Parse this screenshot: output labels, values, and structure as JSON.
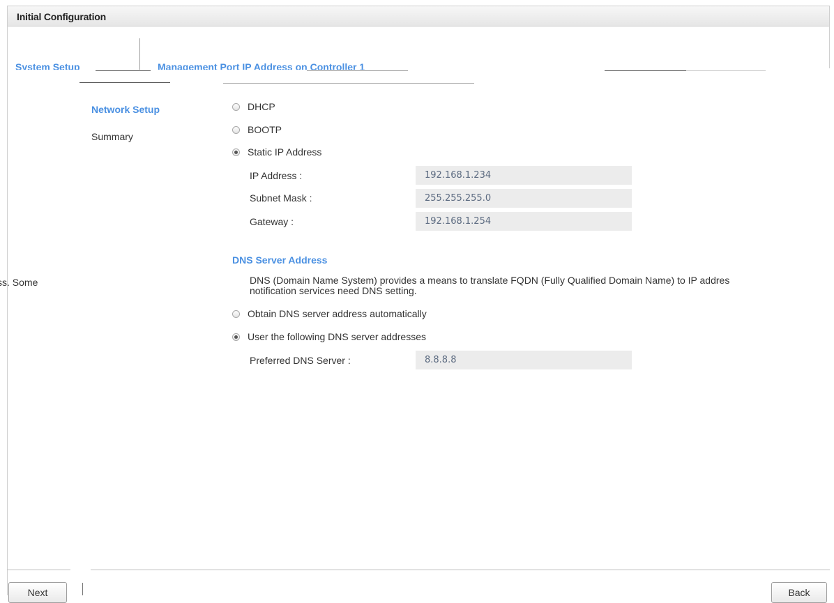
{
  "window": {
    "title": "Initial Configuration"
  },
  "wizard": {
    "top_steps": [
      "System Setup",
      "Management Port IP Address on Controller 1"
    ],
    "steps": [
      "Network Setup",
      "Summary"
    ]
  },
  "ip_config": {
    "options": [
      "DHCP",
      "BOOTP",
      "Static IP Address"
    ],
    "selected": "Static IP Address",
    "fields": [
      {
        "label": "IP Address :",
        "value": "192.168.1.234"
      },
      {
        "label": "Subnet Mask :",
        "value": "255.255.255.0"
      },
      {
        "label": "Gateway :",
        "value": "192.168.1.254"
      }
    ]
  },
  "dns": {
    "title": "DNS Server Address",
    "description_line1": "DNS (Domain Name System) provides a means to translate FQDN (Fully Qualified Domain Name) to IP addres",
    "description_line2": "notification services need DNS setting.",
    "left_clipped_text": "ss. Some",
    "options": [
      "Obtain DNS server address automatically",
      "User the following DNS server addresses"
    ],
    "selected": "User the following DNS server addresses",
    "preferred_label": "Preferred DNS Server :",
    "preferred_value": "8.8.8.8"
  },
  "buttons": {
    "next": "Next",
    "back": "Back"
  }
}
